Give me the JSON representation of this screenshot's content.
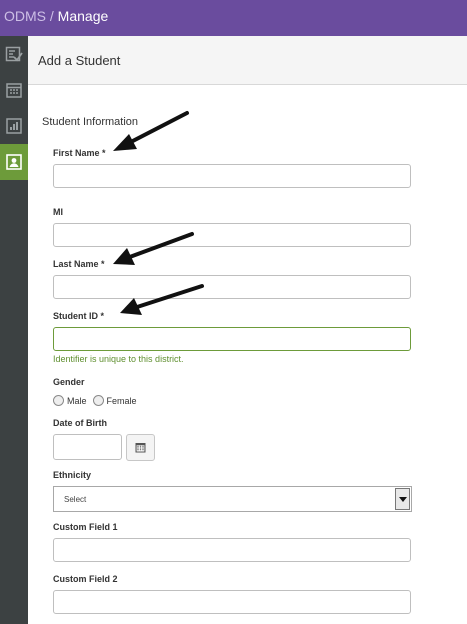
{
  "topbar": {
    "app": "ODMS",
    "separator": " / ",
    "page": "Manage"
  },
  "sidebar": {
    "items": [
      {
        "icon": "checklist-icon"
      },
      {
        "icon": "calendar-icon"
      },
      {
        "icon": "bar-chart-icon"
      },
      {
        "icon": "student-card-icon",
        "active": true
      }
    ]
  },
  "colors": {
    "topbar": "#6a4c9e",
    "sidebar": "#3c4142",
    "active": "#6d9b3a"
  },
  "page": {
    "title": "Add a Student"
  },
  "form": {
    "section_title": "Student Information",
    "first_name": {
      "label": "First Name *",
      "value": ""
    },
    "mi": {
      "label": "MI",
      "value": ""
    },
    "last_name": {
      "label": "Last Name *",
      "value": ""
    },
    "student_id": {
      "label": "Student ID *",
      "value": "",
      "hint": "Identifier is unique to this district."
    },
    "gender": {
      "label": "Gender",
      "options": [
        "Male",
        "Female"
      ]
    },
    "dob": {
      "label": "Date of Birth",
      "value": ""
    },
    "ethnicity": {
      "label": "Ethnicity",
      "selected": "Select"
    },
    "custom1": {
      "label": "Custom Field 1",
      "value": ""
    },
    "custom2": {
      "label": "Custom Field 2",
      "value": ""
    }
  }
}
